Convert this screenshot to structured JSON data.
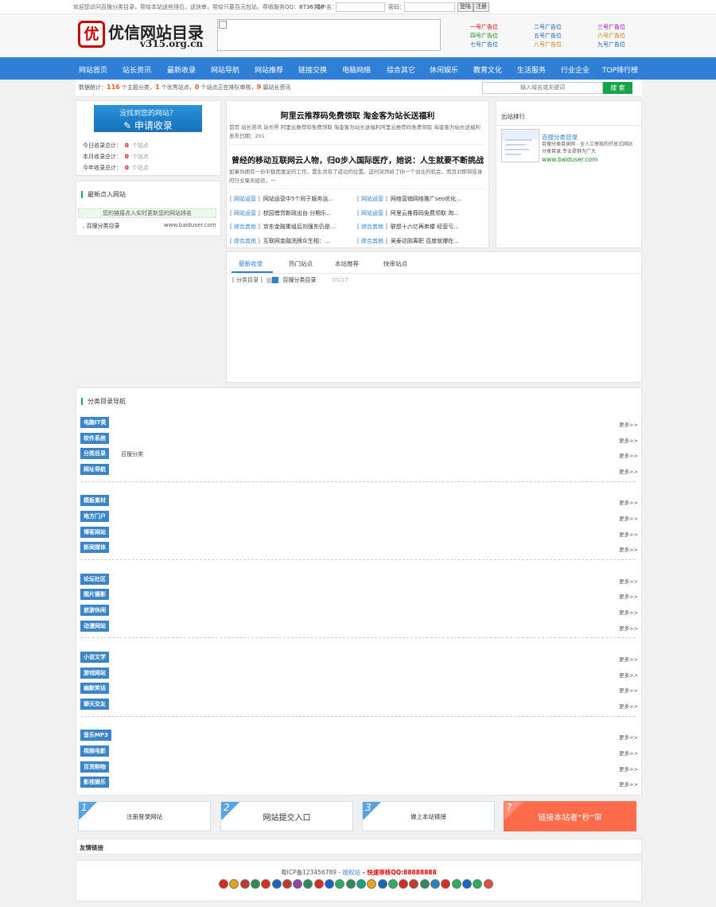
{
  "topbar": {
    "welcome": "欢迎您访问百搜分类目录，帮给本站送些排位，送快审，帮给只要百元包站，帮收服务QQ：",
    "qq": "8736728",
    "user_label": "用户名：",
    "pass_label": "密码：",
    "login": "登陆",
    "register": "注册"
  },
  "header": {
    "logo_char": "优",
    "logo_title": "优信网站目录",
    "logo_domain": "v315.org.cn",
    "ads": [
      {
        "label": "一号广告位",
        "color": "#e00000"
      },
      {
        "label": "二号广告位",
        "color": "#1a5fb4"
      },
      {
        "label": "三号广告位",
        "color": "#a000c0"
      },
      {
        "label": "四号广告位",
        "color": "#1a8a1a"
      },
      {
        "label": "五号广告位",
        "color": "#1a5fb4"
      },
      {
        "label": "六号广告位",
        "color": "#d47a00"
      },
      {
        "label": "七号广告位",
        "color": "#1a5fb4"
      },
      {
        "label": "八号广告位",
        "color": "#d47a00"
      },
      {
        "label": "九号广告位",
        "color": "#1a5fb4"
      }
    ]
  },
  "nav": [
    "网站首页",
    "站长资讯",
    "最新收录",
    "网站导航",
    "网站推荐",
    "链接交换",
    "电脑网络",
    "综合其它",
    "休闲娱乐",
    "教育文化",
    "生活服务",
    "行业企业",
    "TOP排行榜"
  ],
  "stats": {
    "prefix": "数据统计：",
    "n1": "116",
    "t1": " 个主题分类，",
    "n2": "1",
    "t2": " 个优秀站点，",
    "n3": "0",
    "t3": " 个站点正在排队审核，",
    "n4": "9",
    "t4": " 篇站长资讯",
    "search_placeholder": "输入域名或关键词",
    "search_button": "搜 索"
  },
  "left": {
    "apply_line1": "没找到您的网站？",
    "apply_line2": "申请收录",
    "counts": [
      {
        "label": "今日收录总计：",
        "value": "0",
        "unit": "个站点"
      },
      {
        "label": "本月收录总计：",
        "value": "0",
        "unit": "个站点"
      },
      {
        "label": "今年收录总计：",
        "value": "0",
        "unit": "个站点"
      }
    ],
    "recent_title": "最新点入网站",
    "notice": "您的链接点入实时更新您的网站排名",
    "recent_site": "百搜分类目录",
    "recent_url": "www.baiduser.com"
  },
  "center": {
    "headline1": "阿里云推荐码免费领取 淘金客为站长送福利",
    "desc1": "首页 站长资讯 站长界 阿里云推荐码免费领取 淘金客为站长送福利阿里云推荐码免费领取 淘金客为站长送福利 发布日期：201",
    "headline2": "曾经的移动互联网云人物，归0步入国际医疗，她说：人生就要不断挑战",
    "desc2": "如果你拥有一份平稳而富足的工作，置生活有了成功的位置。这时突然给了你一个创业的机会，而且对即将投身的行业毫无经验，一",
    "news": [
      {
        "cat": "[ 网站运营 ]",
        "title": "网站运营中5个同于服务运..."
      },
      {
        "cat": "[ 网站运营 ]",
        "title": "网络营销网络推广seo优化..."
      },
      {
        "cat": "[ 网站运营 ]",
        "title": "校园借贷新政出台 分期乐..."
      },
      {
        "cat": "[ 网站运营 ]",
        "title": "阿里云推荐码免费领取 淘..."
      },
      {
        "cat": "[ 综合其他 ]",
        "title": "京东金融重组后刘强东仍是..."
      },
      {
        "cat": "[ 综合其他 ]",
        "title": "联想十六亿再卖楼 经营亏..."
      },
      {
        "cat": "[ 综合其他 ]",
        "title": "互联网金融洗牌众生相：..."
      },
      {
        "cat": "[ 综合其他 ]",
        "title": "吴泰达刚离职 百度就爆在..."
      }
    ],
    "tabs": [
      "最新收录",
      "热门站点",
      "本站推荐",
      "快审站点"
    ],
    "tab_row": {
      "cat": "[ 分类目录 ]",
      "site": "百搜分类目录",
      "date": "05/17"
    }
  },
  "right": {
    "title": "出站排行",
    "site_name": "百搜分类目录",
    "site_desc": "百搜分类目录网 - 全人工审核的开放式网站分类目录,专业提供为广大",
    "site_url": "www.baiduser.com"
  },
  "directory": {
    "title": "分类目录导航",
    "more": "更多>>",
    "groups": [
      [
        {
          "name": "电脑IT类",
          "sub": ""
        },
        {
          "name": "软件系统",
          "sub": ""
        },
        {
          "name": "分类目录",
          "sub": "百搜分类"
        },
        {
          "name": "网址导航",
          "sub": ""
        }
      ],
      [
        {
          "name": "模板素材",
          "sub": ""
        },
        {
          "name": "地方门户",
          "sub": ""
        },
        {
          "name": "博客网站",
          "sub": ""
        },
        {
          "name": "新闻媒体",
          "sub": ""
        }
      ],
      [
        {
          "name": "论坛社区",
          "sub": ""
        },
        {
          "name": "图片摄影",
          "sub": ""
        },
        {
          "name": "旅游休闲",
          "sub": ""
        },
        {
          "name": "动漫网站",
          "sub": ""
        }
      ],
      [
        {
          "name": "小说文学",
          "sub": ""
        },
        {
          "name": "游戏网站",
          "sub": ""
        },
        {
          "name": "幽默笑话",
          "sub": ""
        },
        {
          "name": "聊天交友",
          "sub": ""
        }
      ],
      [
        {
          "name": "音乐MP3",
          "sub": ""
        },
        {
          "name": "视频电影",
          "sub": ""
        },
        {
          "name": "百货购物",
          "sub": ""
        },
        {
          "name": "影视娱乐",
          "sub": ""
        }
      ]
    ]
  },
  "steps": [
    {
      "num": "1",
      "label": "注册登录网站"
    },
    {
      "num": "2",
      "label": "网站提交入口"
    },
    {
      "num": "3",
      "label": "做上本站链接"
    },
    {
      "num": "?",
      "label": "链接本站者“秒”审"
    }
  ],
  "links_title": "友情链接",
  "footer": {
    "icp": "粤ICP备123456789 - ",
    "icp_link": "授权站",
    "qq": " - 快速审核QQ:88888888",
    "badge_colors": [
      "#d62d20",
      "#e8a317",
      "#c0392b",
      "#2e8b57",
      "#d62d20",
      "#1565c0",
      "#c0392b",
      "#8e44ad",
      "#2e8b57",
      "#d62d20",
      "#1565c0",
      "#27ae60",
      "#2e8b57",
      "#16a085",
      "#e8a317",
      "#1565c0",
      "#27ae60",
      "#d62d20",
      "#c0392b",
      "#2e8b57",
      "#2980b9",
      "#d62d20",
      "#27ae60",
      "#1565c0",
      "#27ae60",
      "#e74c3c"
    ]
  }
}
